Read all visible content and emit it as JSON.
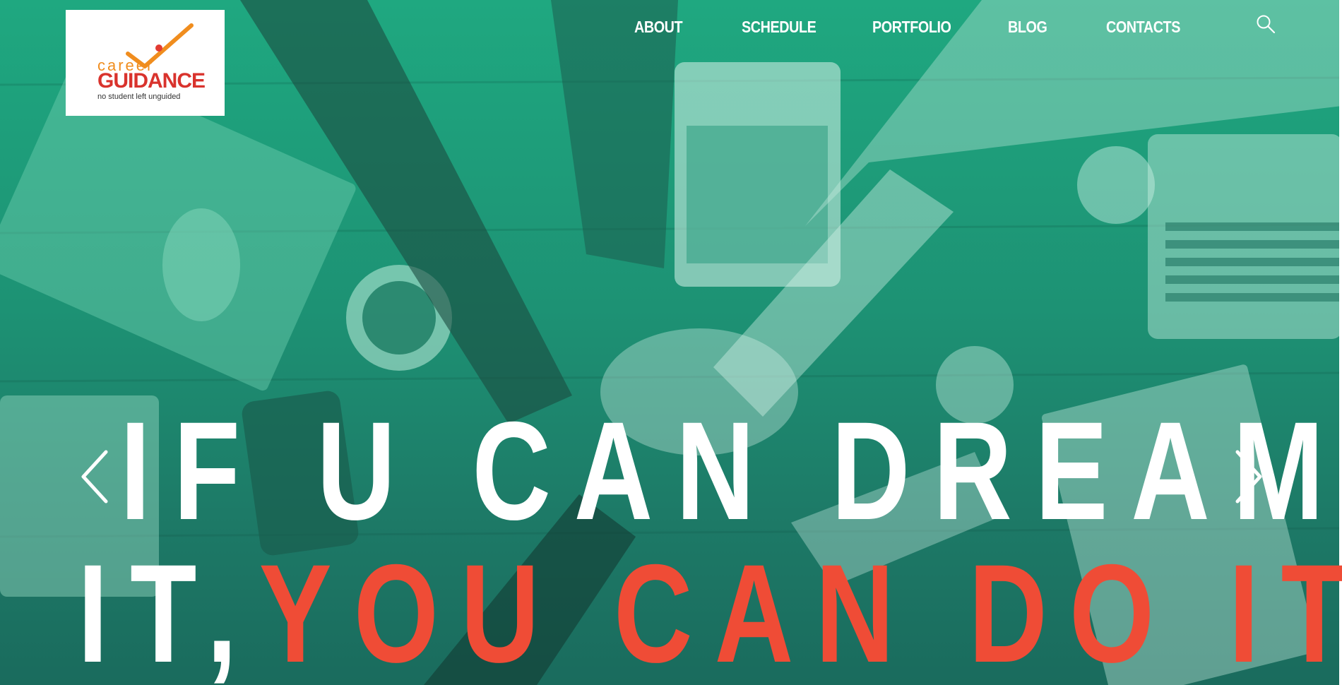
{
  "logo": {
    "word_top": "career",
    "word_main": "GUIDANCE",
    "tagline": "no student left unguided"
  },
  "nav": {
    "items": [
      "ABOUT",
      "SCHEDULE",
      "PORTFOLIO",
      "BLOG",
      "CONTACTS"
    ],
    "search_icon": "search-icon"
  },
  "hero": {
    "line1": "IF U CAN DREAM",
    "line2_white": "IT,",
    "line2_accent": "YOU CAN DO IT",
    "prev_icon": "chevron-left-icon",
    "next_icon": "chevron-right-icon"
  },
  "colors": {
    "overlay": "#1d9274",
    "accent": "#ef4c36",
    "text": "#ffffff"
  }
}
